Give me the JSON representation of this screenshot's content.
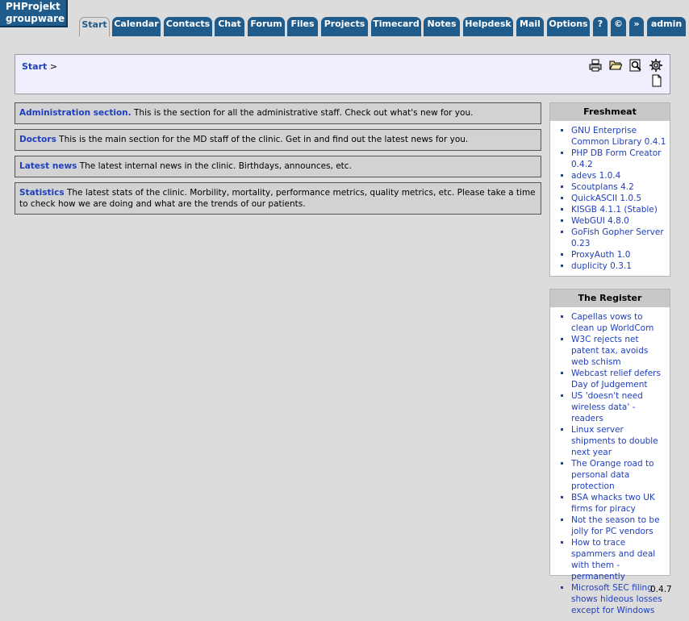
{
  "logo": {
    "line1": "PHProjekt",
    "line2": "groupware"
  },
  "tabs": [
    "Start",
    "Calendar",
    "Contacts",
    "Chat",
    "Forum",
    "Files",
    "Projects",
    "Timecard",
    "Notes",
    "Helpdesk",
    "Mail",
    "Options",
    "?",
    "©",
    "»",
    "admin"
  ],
  "active_tab": "Start",
  "breadcrumb": {
    "link": "Start",
    "separator": ">"
  },
  "toolbar_icons": [
    "print-icon",
    "folder-open-icon",
    "search-icon",
    "settings-icon",
    "new-document-icon"
  ],
  "sections": [
    {
      "title": "Administration section.",
      "text": "This is the section for all the administrative staff. Check out what's new for you."
    },
    {
      "title": "Doctors",
      "text": "This is the main section for the MD staff of the clinic. Get in and find out the latest news for you."
    },
    {
      "title": "Latest news",
      "text": "The latest internal news in the clinic. Birthdays, announces, etc."
    },
    {
      "title": "Statistics",
      "text": "The latest stats of the clinic. Morbility, mortality, performance metrics, quality metrics, etc. Please take a time to check how we are doing and what are the trends of our patients."
    }
  ],
  "freshmeat": {
    "title": "Freshmeat",
    "items": [
      "GNU Enterprise Common Library 0.4.1",
      "PHP DB Form Creator 0.4.2",
      "adevs 1.0.4",
      "Scoutplans 4.2",
      "QuickASCII 1.0.5",
      "KISGB 4.1.1 (Stable)",
      "WebGUI 4.8.0",
      "GoFish Gopher Server 0.23",
      "ProxyAuth 1.0",
      "duplicity 0.3.1"
    ]
  },
  "register": {
    "title": "The Register",
    "items": [
      "Capellas vows to clean up WorldCom",
      "W3C rejects net patent tax, avoids web schism",
      "Webcast relief defers Day of Judgement",
      "US 'doesn't need wireless data' - readers",
      "Linux server shipments to double next year",
      "The Orange road to personal data protection",
      "BSA whacks two UK firms for piracy",
      "Not the season to be jolly for PC vendors",
      "How to trace spammers and deal with them - permanently",
      "Microsoft SEC filing shows hideous losses except for Windows"
    ]
  },
  "version": "0.4.7",
  "colors": {
    "tab": "#1f5c8c",
    "link": "#1f3fbf",
    "background": "#dcdcdc"
  }
}
